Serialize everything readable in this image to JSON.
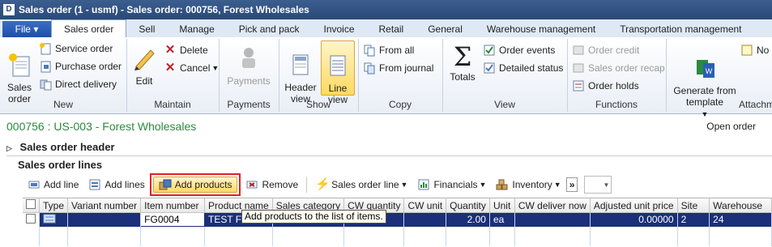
{
  "window": {
    "title": "Sales order (1 - usmf) - Sales order: 000756, Forest Wholesales"
  },
  "ribbon_tabs": [
    {
      "label": "File"
    },
    {
      "label": "Sales order"
    },
    {
      "label": "Sell"
    },
    {
      "label": "Manage"
    },
    {
      "label": "Pick and pack"
    },
    {
      "label": "Invoice"
    },
    {
      "label": "Retail"
    },
    {
      "label": "General"
    },
    {
      "label": "Warehouse management"
    },
    {
      "label": "Transportation management"
    }
  ],
  "ribbon": {
    "new": {
      "label": "New",
      "sales_order": "Sales\norder",
      "service_order": "Service order",
      "purchase_order": "Purchase order",
      "direct_delivery": "Direct delivery"
    },
    "maintain": {
      "label": "Maintain",
      "edit": "Edit",
      "delete": "Delete",
      "cancel": "Cancel"
    },
    "payments": {
      "label": "Payments",
      "payments": "Payments"
    },
    "show": {
      "label": "Show",
      "header_view": "Header\nview",
      "line_view": "Line\nview"
    },
    "copy": {
      "label": "Copy",
      "from_all": "From all",
      "from_journal": "From journal"
    },
    "view": {
      "label": "View",
      "totals": "Totals",
      "order_events": "Order events",
      "detailed_status": "Detailed status"
    },
    "functions": {
      "label": "Functions",
      "order_credit": "Order credit",
      "sales_order_recap": "Sales order recap",
      "order_holds": "Order holds"
    },
    "attachments": {
      "label": "Attachme",
      "generate_from_template": "Generate from\ntemplate",
      "notes": "No"
    }
  },
  "record": {
    "title": "000756 : US-003 - Forest Wholesales",
    "open_order": "Open order"
  },
  "fasttabs": {
    "header": "Sales order header",
    "lines": "Sales order lines"
  },
  "lines_toolbar": {
    "add_line": "Add line",
    "add_lines": "Add lines",
    "add_products": "Add products",
    "remove": "Remove",
    "sales_order_line": "Sales order line",
    "financials": "Financials",
    "inventory": "Inventory",
    "more": "»"
  },
  "grid": {
    "columns": [
      "Type",
      "Variant number",
      "Item number",
      "Product name",
      "Sales category",
      "CW quantity",
      "CW unit",
      "Quantity",
      "Unit",
      "CW deliver now",
      "Adjusted unit price",
      "Site",
      "Warehouse"
    ],
    "rows": [
      {
        "type": "",
        "variant_number": "",
        "item_number": "FG0004",
        "product_name": "TEST FG",
        "sales_category": "",
        "cw_quantity": "",
        "cw_unit": "",
        "quantity": "2.00",
        "unit": "ea",
        "cw_deliver_now": "",
        "adjusted_unit_price": "0.00000",
        "site": "2",
        "warehouse": "24"
      }
    ]
  },
  "tooltip": {
    "text": "Add products to the list of items."
  },
  "colors": {
    "accent": "#1d4fa6",
    "selected_row": "#1b2f7a",
    "highlight_box": "#e0202a",
    "record_title": "#2b8a3e"
  }
}
